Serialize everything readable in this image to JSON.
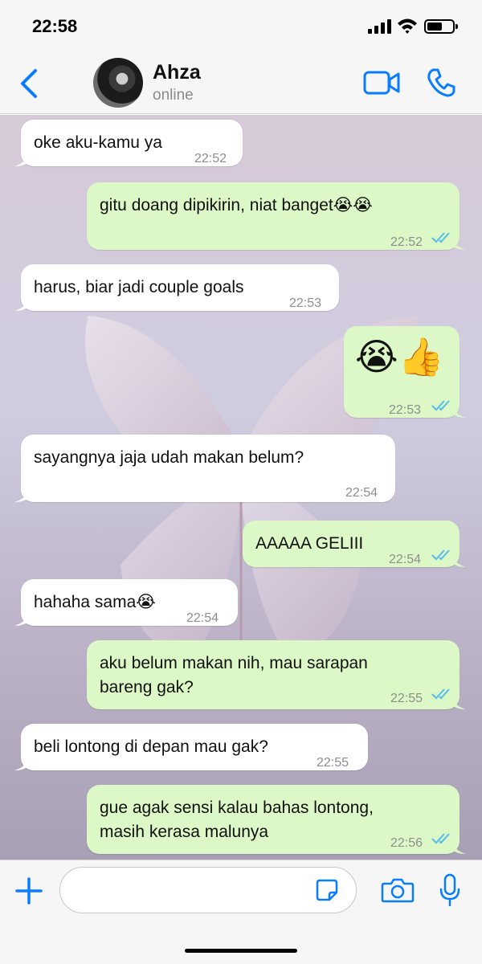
{
  "status_bar": {
    "time": "22:58"
  },
  "header": {
    "contact_name": "Ahza",
    "contact_status": "online"
  },
  "messages": [
    {
      "dir": "in",
      "text": "oke aku-kamu ya",
      "time": "22:52"
    },
    {
      "dir": "out",
      "text": "gitu doang dipikirin, niat banget😭😭",
      "time": "22:52",
      "read": true
    },
    {
      "dir": "in",
      "text": "harus, biar jadi couple goals",
      "time": "22:53"
    },
    {
      "dir": "out",
      "text": "😭👍",
      "time": "22:53",
      "read": true
    },
    {
      "dir": "in",
      "text": "sayangnya jaja udah makan belum?",
      "time": "22:54"
    },
    {
      "dir": "out",
      "text": "AAAAA GELIII",
      "time": "22:54",
      "read": true
    },
    {
      "dir": "in",
      "text": "hahaha sama😭",
      "time": "22:54"
    },
    {
      "dir": "out",
      "text": "aku belum makan nih, mau sarapan\nbareng gak?",
      "time": "22:55",
      "read": true
    },
    {
      "dir": "in",
      "text": "beli lontong di depan mau gak?",
      "time": "22:55"
    },
    {
      "dir": "out",
      "text": "gue agak sensi kalau bahas lontong,\nmasih kerasa malunya",
      "time": "22:56",
      "read": true
    }
  ],
  "composer": {
    "input_value": ""
  },
  "colors": {
    "accent": "#0a7cff",
    "outgoing_bubble": "#dcf8c6",
    "incoming_bubble": "#ffffff",
    "read_ticks": "#53bdeb"
  }
}
